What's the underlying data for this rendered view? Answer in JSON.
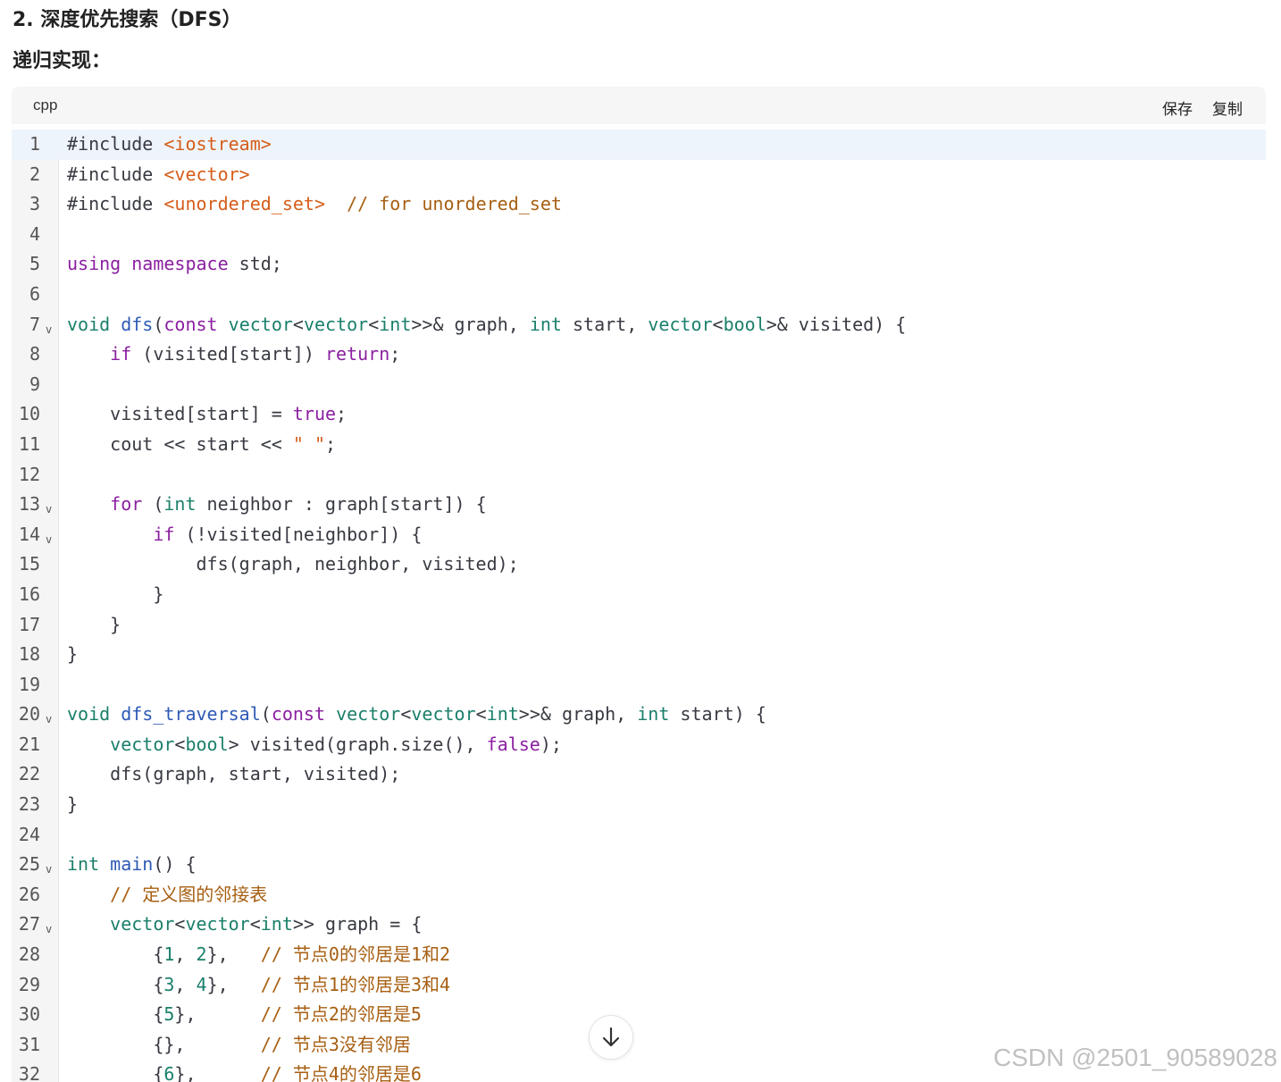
{
  "heading": "2. 深度优先搜索（DFS）",
  "subheading": "递归实现：",
  "code_block": {
    "language": "cpp",
    "save_label": "保存",
    "copy_label": "复制",
    "lines": [
      {
        "n": "1",
        "fold": false,
        "html": "#include <span class=\"str\">&lt;iostream&gt;</span>"
      },
      {
        "n": "2",
        "fold": false,
        "html": "#include <span class=\"str\">&lt;vector&gt;</span>"
      },
      {
        "n": "3",
        "fold": false,
        "html": "#include <span class=\"str\">&lt;unordered_set&gt;</span>  <span class=\"cm\">// for unordered_set</span>"
      },
      {
        "n": "4",
        "fold": false,
        "html": ""
      },
      {
        "n": "5",
        "fold": false,
        "html": "<span class=\"kw\">using namespace</span> std;"
      },
      {
        "n": "6",
        "fold": false,
        "html": ""
      },
      {
        "n": "7",
        "fold": true,
        "html": "<span class=\"ty\">void</span> <span class=\"fn\">dfs</span>(<span class=\"kw\">const</span> <span class=\"ty\">vector</span>&lt;<span class=\"ty\">vector</span>&lt;<span class=\"ty\">int</span>&gt;&gt;&amp; graph, <span class=\"ty\">int</span> start, <span class=\"ty\">vector</span>&lt;<span class=\"ty\">bool</span>&gt;&amp; visited) {"
      },
      {
        "n": "8",
        "fold": false,
        "html": "    <span class=\"kw\">if</span> (visited[start]) <span class=\"kw\">return</span>;"
      },
      {
        "n": "9",
        "fold": false,
        "html": ""
      },
      {
        "n": "10",
        "fold": false,
        "html": "    visited[start] = <span class=\"kw\">true</span>;"
      },
      {
        "n": "11",
        "fold": false,
        "html": "    cout &lt;&lt; start &lt;&lt; <span class=\"str\">\" \"</span>;"
      },
      {
        "n": "12",
        "fold": false,
        "html": ""
      },
      {
        "n": "13",
        "fold": true,
        "html": "    <span class=\"kw\">for</span> (<span class=\"ty\">int</span> neighbor : graph[start]) {"
      },
      {
        "n": "14",
        "fold": true,
        "html": "        <span class=\"kw\">if</span> (!visited[neighbor]) {"
      },
      {
        "n": "15",
        "fold": false,
        "html": "            dfs(graph, neighbor, visited);"
      },
      {
        "n": "16",
        "fold": false,
        "html": "        }"
      },
      {
        "n": "17",
        "fold": false,
        "html": "    }"
      },
      {
        "n": "18",
        "fold": false,
        "html": "}"
      },
      {
        "n": "19",
        "fold": false,
        "html": ""
      },
      {
        "n": "20",
        "fold": true,
        "html": "<span class=\"ty\">void</span> <span class=\"fn\">dfs_traversal</span>(<span class=\"kw\">const</span> <span class=\"ty\">vector</span>&lt;<span class=\"ty\">vector</span>&lt;<span class=\"ty\">int</span>&gt;&gt;&amp; graph, <span class=\"ty\">int</span> start) {"
      },
      {
        "n": "21",
        "fold": false,
        "html": "    <span class=\"ty\">vector</span>&lt;<span class=\"ty\">bool</span>&gt; visited(graph.size(), <span class=\"kw\">false</span>);"
      },
      {
        "n": "22",
        "fold": false,
        "html": "    dfs(graph, start, visited);"
      },
      {
        "n": "23",
        "fold": false,
        "html": "}"
      },
      {
        "n": "24",
        "fold": false,
        "html": ""
      },
      {
        "n": "25",
        "fold": true,
        "html": "<span class=\"ty\">int</span> <span class=\"fn\">main</span>() {"
      },
      {
        "n": "26",
        "fold": false,
        "html": "    <span class=\"cm\">// 定义图的邻接表</span>"
      },
      {
        "n": "27",
        "fold": true,
        "html": "    <span class=\"ty\">vector</span>&lt;<span class=\"ty\">vector</span>&lt;<span class=\"ty\">int</span>&gt;&gt; graph = {"
      },
      {
        "n": "28",
        "fold": false,
        "html": "        {<span class=\"num\">1</span>, <span class=\"num\">2</span>},   <span class=\"cm\">// 节点0的邻居是1和2</span>"
      },
      {
        "n": "29",
        "fold": false,
        "html": "        {<span class=\"num\">3</span>, <span class=\"num\">4</span>},   <span class=\"cm\">// 节点1的邻居是3和4</span>"
      },
      {
        "n": "30",
        "fold": false,
        "html": "        {<span class=\"num\">5</span>},      <span class=\"cm\">// 节点2的邻居是5</span>"
      },
      {
        "n": "31",
        "fold": false,
        "html": "        {},       <span class=\"cm\">// 节点3没有邻居</span>"
      },
      {
        "n": "32",
        "fold": false,
        "html": "        {<span class=\"num\">6</span>},      <span class=\"cm\">// 节点4的邻居是6</span>"
      }
    ]
  },
  "watermark": "CSDN @2501_90589028"
}
